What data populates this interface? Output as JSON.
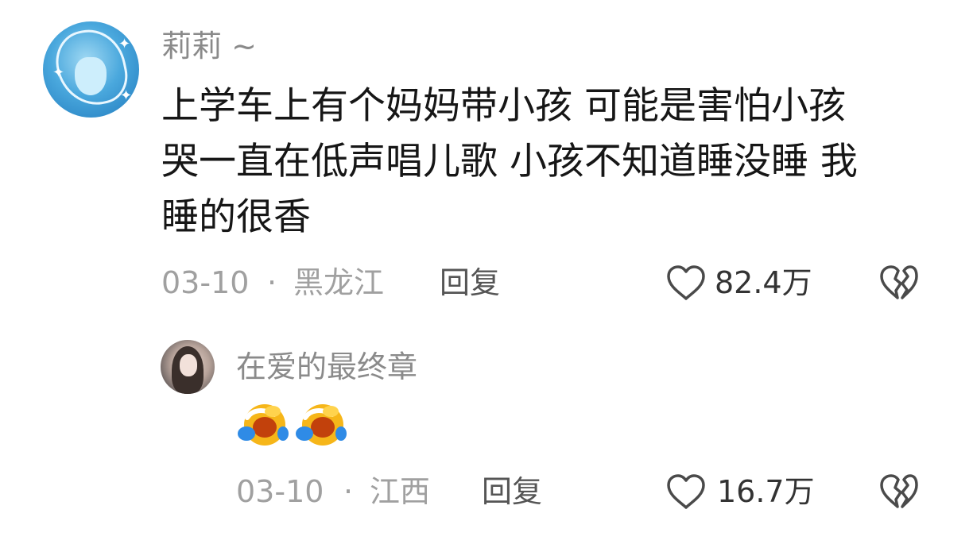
{
  "comments": [
    {
      "username": "莉莉 ~",
      "text_lines": [
        "上学车上有个妈妈带小孩  可能是害怕小孩",
        "哭一直在低声唱儿歌  小孩不知道睡没睡  我",
        "睡的很香"
      ],
      "date": "03-10",
      "separator": "·",
      "location": "黑龙江",
      "reply_label": "回复",
      "likes": "82.4万",
      "icons": {
        "avatar": "avatar-anime",
        "like": "heart-outline-icon",
        "dislike": "broken-heart-icon"
      }
    },
    {
      "username": "在爱的最终章",
      "emojis": [
        "crying-emoji",
        "crying-emoji"
      ],
      "date": "03-10",
      "separator": "·",
      "location": "江西",
      "reply_label": "回复",
      "likes": "16.7万",
      "icons": {
        "avatar": "avatar-photo",
        "like": "heart-outline-icon",
        "dislike": "broken-heart-icon"
      }
    }
  ]
}
